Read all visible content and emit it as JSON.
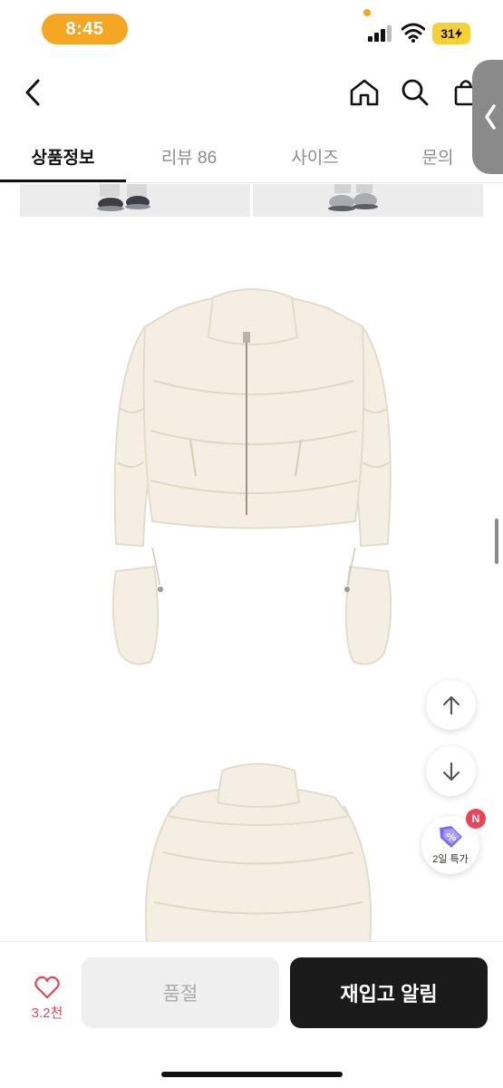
{
  "status_bar": {
    "time": "8:45",
    "battery": "31"
  },
  "tabs": [
    {
      "label": "상품정보"
    },
    {
      "label": "리뷰 86"
    },
    {
      "label": "사이즈"
    },
    {
      "label": "문의"
    }
  ],
  "floating": {
    "promo_label": "2일 특가",
    "badge": "N"
  },
  "bottom": {
    "like_count": "3.2천",
    "soldout_label": "품절",
    "restock_label": "재입고 알림"
  },
  "colors": {
    "time_pill": "#f5a623",
    "battery": "#f7d036",
    "like": "#e8455a",
    "primary_button": "#1a1a1a",
    "jacket": "#f4efe2"
  }
}
